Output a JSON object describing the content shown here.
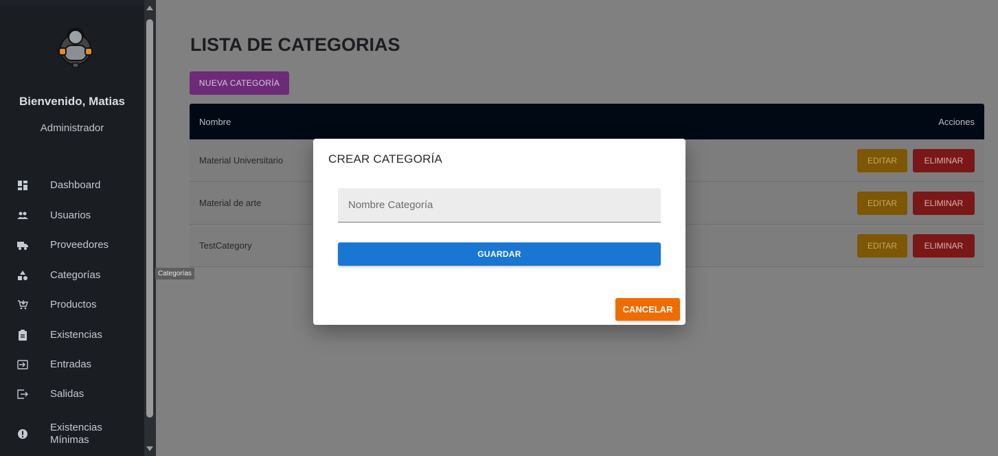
{
  "sidebar": {
    "welcome": "Bienvenido, Matias",
    "role": "Administrador",
    "items": [
      {
        "label": "Dashboard",
        "icon": "dashboard-icon"
      },
      {
        "label": "Usuarios",
        "icon": "users-icon"
      },
      {
        "label": "Proveedores",
        "icon": "truck-icon"
      },
      {
        "label": "Categorías",
        "icon": "category-icon"
      },
      {
        "label": "Productos",
        "icon": "cart-icon"
      },
      {
        "label": "Existencias",
        "icon": "clipboard-icon"
      },
      {
        "label": "Entradas",
        "icon": "input-icon"
      },
      {
        "label": "Salidas",
        "icon": "output-icon"
      },
      {
        "label": "Existencias Mínimas",
        "icon": "alert-icon"
      }
    ]
  },
  "tooltip": "Categorías",
  "main": {
    "title": "LISTA DE CATEGORIAS",
    "new_button": "NUEVA CATEGORÍA",
    "table": {
      "columns": [
        "Nombre",
        "Acciones"
      ],
      "rows": [
        {
          "name": "Material Universitario"
        },
        {
          "name": "Material de arte"
        },
        {
          "name": "TestCategory"
        }
      ],
      "edit_label": "EDITAR",
      "delete_label": "ELIMINAR"
    }
  },
  "modal": {
    "title": "CREAR CATEGORÍA",
    "input_placeholder": "Nombre Categoría",
    "input_value": "",
    "save_label": "GUARDAR",
    "cancel_label": "CANCELAR"
  },
  "colors": {
    "sidebar_bg": "#1a1d22",
    "header_bg": "#010915",
    "primary": "#1976d2",
    "cancel": "#ef6c00",
    "new_button": "#9c27b0",
    "edit": "#ff9800",
    "delete": "#d32f2f"
  }
}
